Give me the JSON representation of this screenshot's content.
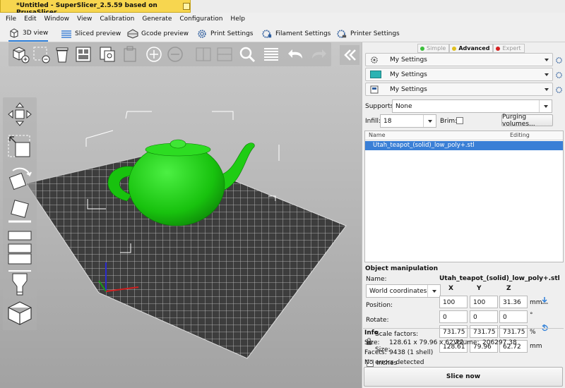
{
  "window": {
    "title": "*Untitled - SuperSlicer_2.5.59  based on PrusaSlicer"
  },
  "menu": [
    "File",
    "Edit",
    "Window",
    "View",
    "Calibration",
    "Generate",
    "Configuration",
    "Help"
  ],
  "tabs": [
    {
      "label": "3D view",
      "icon": "cube-icon",
      "active": true
    },
    {
      "label": "Sliced preview",
      "icon": "layers-icon",
      "active": false
    },
    {
      "label": "Gcode preview",
      "icon": "gcode-icon",
      "active": false
    },
    {
      "label": "Print Settings",
      "icon": "gear-icon",
      "active": false
    },
    {
      "label": "Filament Settings",
      "icon": "spool-gear-icon",
      "active": false
    },
    {
      "label": "Printer Settings",
      "icon": "printer-gear-icon",
      "active": false
    }
  ],
  "toolbar": {
    "top_icons": [
      "add-icon",
      "delete-icon",
      "delete-all-icon",
      "arrange-icon",
      "copy-icon",
      "paste-icon",
      "add-instance-icon",
      "remove-instance-icon",
      "split-objects-icon",
      "split-parts-icon",
      "search-icon",
      "layer-editing-icon",
      "undo-icon",
      "redo-icon"
    ],
    "left_icons": [
      "move-icon",
      "scale-icon",
      "rotate-icon",
      "place-on-face-icon",
      "cut-icon",
      "paint-supports-icon",
      "seam-paint-icon",
      "sla-hollow-icon"
    ]
  },
  "modes": {
    "items": [
      {
        "label": "Simple",
        "color": "#3bbf3b",
        "active": false
      },
      {
        "label": "Advanced",
        "color": "#e0c020",
        "active": true
      },
      {
        "label": "Expert",
        "color": "#d62020",
        "active": false
      }
    ]
  },
  "presets": [
    {
      "label": "My Settings",
      "icon": "print-gear-icon"
    },
    {
      "label": "My Settings",
      "icon": "filament-swatch-icon",
      "swatch": "#2bb3b3"
    },
    {
      "label": "My Settings",
      "icon": "printer-icon"
    }
  ],
  "settings": {
    "supports_label": "Supports:",
    "supports_value": "None",
    "infill_label": "Infill:",
    "infill_value": "18",
    "brim_label": "Brim:",
    "purging_button": "Purging volumes..."
  },
  "objects": {
    "col_name": "Name",
    "col_editing": "Editing",
    "rows": [
      "Utah_teapot_(solid)_low_poly+.stl"
    ]
  },
  "manipulation": {
    "title": "Object manipulation",
    "name_label": "Name:",
    "name_value": "Utah_teapot_(solid)_low_poly+.stl",
    "coords": "World coordinates",
    "axes": [
      "X",
      "Y",
      "Z"
    ],
    "position_label": "Position:",
    "position": [
      "100",
      "100",
      "31.36"
    ],
    "position_unit": "mm",
    "rotate_label": "Rotate:",
    "rotate": [
      "0",
      "0",
      "0"
    ],
    "rotate_unit": "°",
    "scale_label": "Scale factors:",
    "scale": [
      "731.75",
      "731.75",
      "731.75"
    ],
    "scale_unit": "%",
    "size_label": "Size:",
    "size": [
      "128.61",
      "79.96",
      "62.72"
    ],
    "size_unit": "mm",
    "inches_label": "Inches"
  },
  "info": {
    "title": "Info",
    "size_label": "Size:",
    "size_value": "128.61 x 79.96 x 62.72",
    "volume_label": "Volume:",
    "volume_value": "206297.38",
    "facets_label": "Facets:",
    "facets_value": "9438 (1 shell)",
    "errors": "No errors detected"
  },
  "slice_button": "Slice now",
  "colors": {
    "accent": "#3a7fd6",
    "model": "#19c90e",
    "title_bar": "#f7d64f"
  }
}
